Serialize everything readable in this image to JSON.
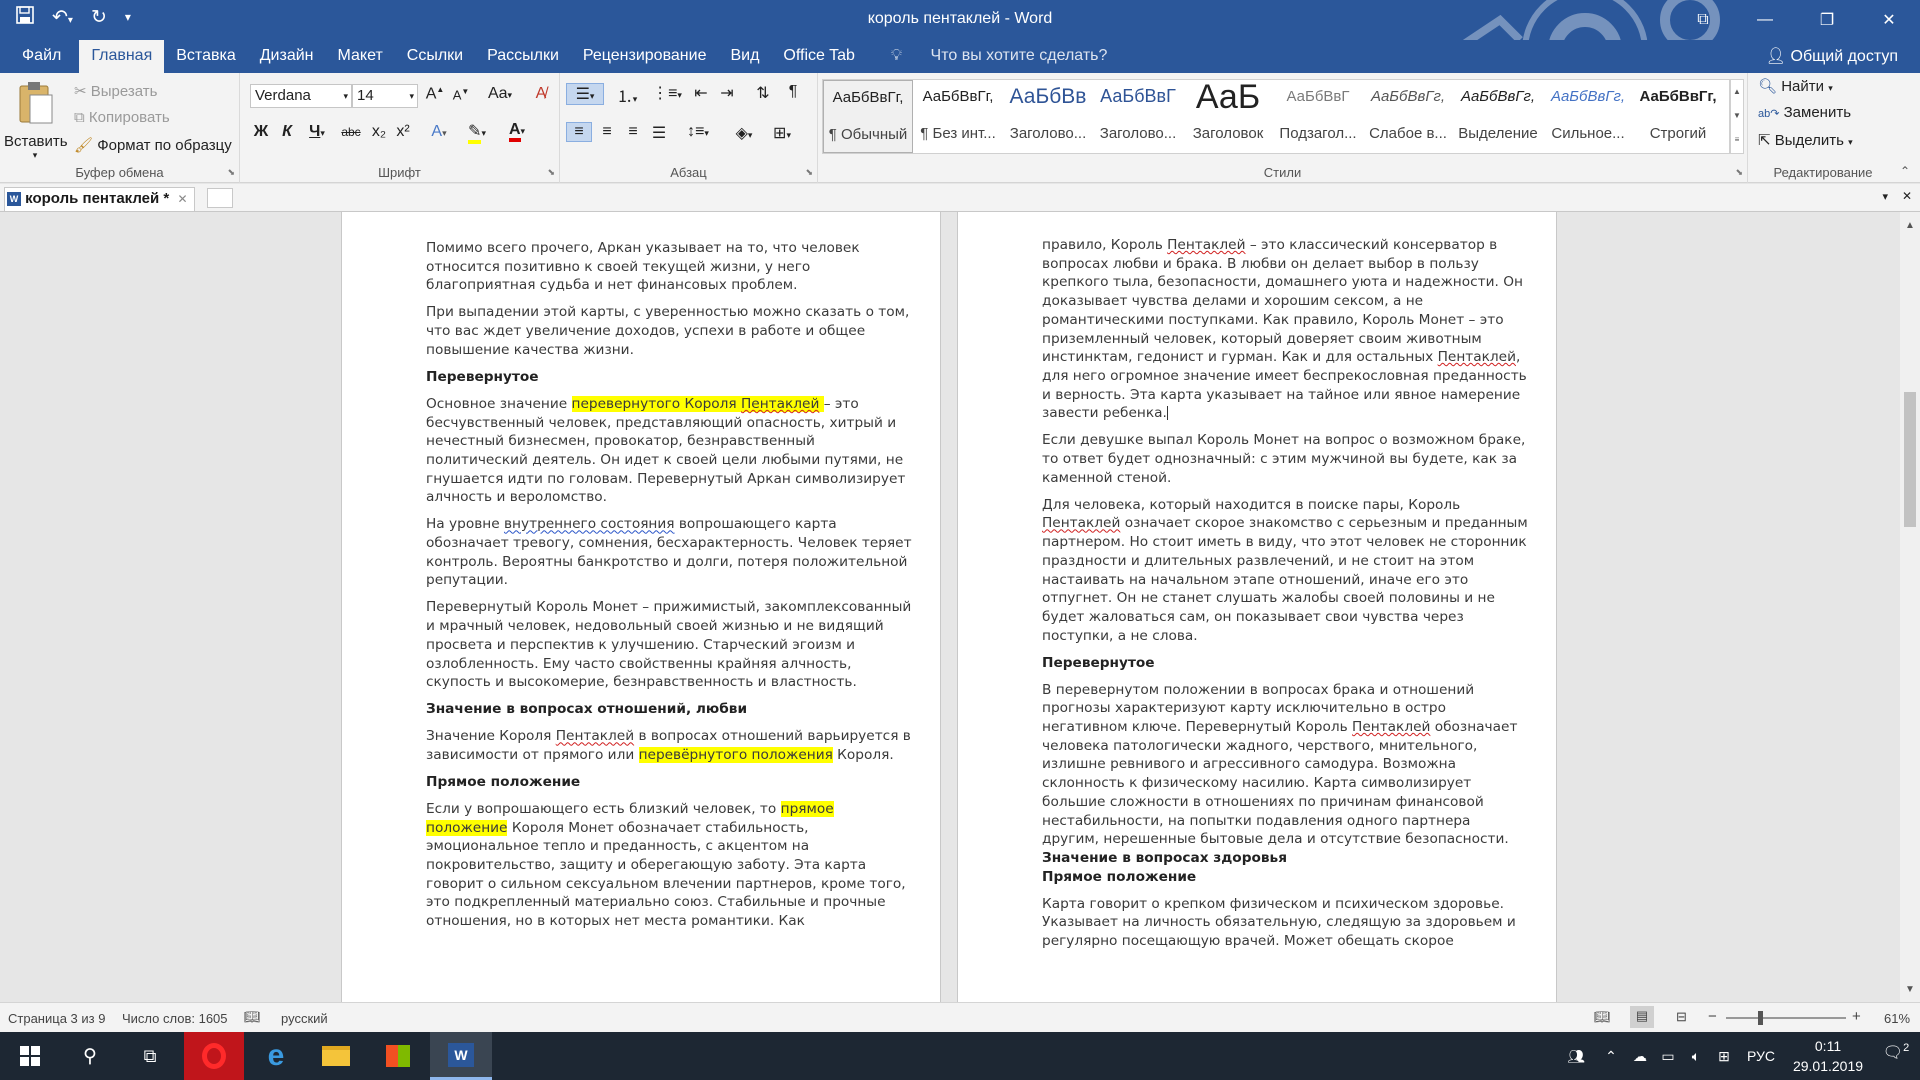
{
  "titlebar": {
    "title": "король пентаклей - Word",
    "share": "Общий доступ"
  },
  "tabs": [
    "Файл",
    "Главная",
    "Вставка",
    "Дизайн",
    "Макет",
    "Ссылки",
    "Рассылки",
    "Рецензирование",
    "Вид",
    "Office Tab"
  ],
  "tell_me": "Что вы хотите сделать?",
  "clipboard": {
    "paste": "Вставить",
    "cut": "Вырезать",
    "copy": "Копировать",
    "format_painter": "Формат по образцу",
    "label": "Буфер обмена"
  },
  "font": {
    "name": "Verdana",
    "size": "14",
    "label": "Шрифт",
    "bold": "Ж",
    "italic": "К",
    "underline": "Ч",
    "strike": "abc",
    "sub": "x₂",
    "sup": "x²",
    "case": "Aa",
    "grow": "A",
    "shrink": "A",
    "color": "A"
  },
  "paragraph": {
    "label": "Абзац"
  },
  "styles": {
    "label": "Стили",
    "items": [
      {
        "preview": "АаБбВвГг,",
        "name": "¶ Обычный",
        "color": "#1a1a1a"
      },
      {
        "preview": "АаБбВвГг,",
        "name": "¶ Без инт...",
        "color": "#1a1a1a"
      },
      {
        "preview": "АаБбВв",
        "name": "Заголово...",
        "color": "#2f5496"
      },
      {
        "preview": "АаБбВвГ",
        "name": "Заголово...",
        "color": "#2f5496"
      },
      {
        "preview": "АаБ",
        "name": "Заголовок",
        "color": "#1a1a1a"
      },
      {
        "preview": "АаБбВвГ",
        "name": "Подзагол...",
        "color": "#7a7a7a"
      },
      {
        "preview": "АаБбВвГг,",
        "name": "Слабое в...",
        "color": "#555555"
      },
      {
        "preview": "АаБбВвГг,",
        "name": "Выделение",
        "color": "#1a1a1a"
      },
      {
        "preview": "АаБбВвГг,",
        "name": "Сильное...",
        "color": "#4472c4"
      },
      {
        "preview": "АаБбВвГг,",
        "name": "Строгий",
        "color": "#1a1a1a"
      }
    ]
  },
  "editing": {
    "find": "Найти",
    "replace": "Заменить",
    "select": "Выделить",
    "label": "Редактирование"
  },
  "doc_tab": {
    "name": "король пентаклей *"
  },
  "left_page": {
    "p1": "Помимо всего прочего, Аркан указывает на то, что человек относится позитивно к своей текущей жизни, у него благоприятная судьба и нет финансовых проблем.",
    "p2": "При выпадении этой карты, с уверенностью можно сказать о том, что вас ждет увеличение доходов, успехи в работе и общее повышение качества жизни.",
    "h1": "Перевернутое",
    "p3a": "Основное значение ",
    "p3hl1": "перевернутого Короля ",
    "p3hl2": "Пентаклей",
    "p3hl3": " ",
    "p3b": " – это бесчувственный человек, представляющий опасность, хитрый и нечестный бизнесмен, провокатор, безнравственный политический деятель. Он идет к своей цели любыми путями, не гнушается идти по головам. Перевернутый Аркан символизирует алчность и вероломство.",
    "p4a": "На уровне ",
    "p4b": "внутреннего состояния",
    "p4c": " вопрошающего карта обозначает тревогу, сомнения, бесхарактерность. Человек теряет контроль. Вероятны банкротство и долги, потеря положительной репутации.",
    "p5": "Перевернутый Король Монет – прижимистый, закомплексованный и мрачный человек, недовольный своей жизнью и не видящий просвета и перспектив к улучшению. Старческий эгоизм и озлобленность. Ему часто свойственны крайняя алчность, скупость и высокомерие, безнравственность и властность.",
    "h2": "Значение в вопросах отношений, любви",
    "p6a": "Значение Короля ",
    "p6b": "Пентаклей",
    "p6c": " в вопросах отношений варьируется в зависимости от прямого или ",
    "p6hl": "перевёрнутого положения",
    "p6d": " Короля.",
    "h3": "Прямое положение",
    "p7a": "Если у вопрошающего есть близкий человек, то ",
    "p7hl": "прямое положение",
    "p7b": " Короля Монет обозначает стабильность, эмоциональное тепло и преданность, с акцентом на покровительство, защиту и оберегающую заботу. Эта карта говорит о сильном сексуальном влечении партнеров, кроме того, это подкрепленный материально союз. Стабильные и прочные отношения, но в которых нет места романтики. Как"
  },
  "right_page": {
    "p1a": "правило, Король ",
    "p1b": "Пентаклей",
    "p1c": " – это классический консерватор в вопросах любви и брака. В любви он делает выбор в пользу крепкого тыла, безопасности, домашнего уюта и надежности. Он доказывает чувства делами и хорошим сексом, а не романтическими поступками. Как правило, Король Монет – это приземленный человек, который доверяет своим животным инстинктам, гедонист и гурман. Как и для остальных ",
    "p1d": "Пентаклей",
    "p1e": ", для него огромное значение имеет беспрекословная преданность и верность. Эта карта указывает на тайное или явное намерение завести ребенка.",
    "p2": "Если девушке выпал Король Монет на вопрос о возможном браке, то ответ будет однозначный: с этим мужчиной вы будете, как за каменной стеной.",
    "p3a": "Для человека, который находится в поиске пары, Король ",
    "p3b": "Пентаклей",
    "p3c": " означает скорое знакомство с серьезным и преданным партнером. Но стоит иметь в виду, что этот человек не сторонник праздности и длительных развлечений, и не стоит на этом настаивать на начальном этапе отношений, иначе его это отпугнет. Он не станет слушать жалобы своей половины и не будет жаловаться сам, он показывает свои чувства через поступки, а не слова.",
    "h1": "Перевернутое",
    "p4a": "В перевернутом положении в вопросах брака и отношений прогнозы характеризуют карту исключительно в остро негативном ключе. Перевернутый Король ",
    "p4b": "Пентаклей",
    "p4c": " обозначает человека патологически жадного, черствого, мнительного, излишне ревнивого и агрессивного самодура. Возможна склонность к физическому насилию. Карта символизирует большие сложности в отношениях по причинам финансовой нестабильности, на попытки подавления одного партнера другим, нерешенные бытовые дела и отсутствие безопасности.",
    "h2": "Значение в вопросах здоровья",
    "h3": "Прямое положение",
    "p5": "Карта говорит о крепком физическом и психическом здоровье. Указывает на личность обязательную, следящую за здоровьем и регулярно посещающую врачей. Может обещать скорое"
  },
  "status": {
    "page": "Страница 3 из 9",
    "words": "Число слов: 1605",
    "lang": "русский",
    "zoom": "61%",
    "zoom_level": 0.61
  },
  "taskbar": {
    "lang": "РУС",
    "time": "0:11",
    "date": "29.01.2019",
    "notif": "2"
  }
}
